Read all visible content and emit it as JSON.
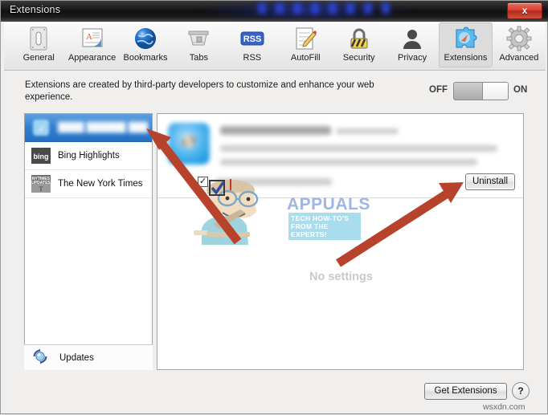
{
  "window": {
    "title": "Extensions",
    "close_label": "x"
  },
  "toolbar": {
    "items": [
      {
        "label": "General",
        "icon": "general-icon",
        "active": false
      },
      {
        "label": "Appearance",
        "icon": "appearance-icon",
        "active": false
      },
      {
        "label": "Bookmarks",
        "icon": "bookmarks-icon",
        "active": false
      },
      {
        "label": "Tabs",
        "icon": "tabs-icon",
        "active": false
      },
      {
        "label": "RSS",
        "icon": "rss-icon",
        "active": false
      },
      {
        "label": "AutoFill",
        "icon": "autofill-icon",
        "active": false
      },
      {
        "label": "Security",
        "icon": "security-icon",
        "active": false
      },
      {
        "label": "Privacy",
        "icon": "privacy-icon",
        "active": false
      },
      {
        "label": "Extensions",
        "icon": "extensions-icon",
        "active": true
      },
      {
        "label": "Advanced",
        "icon": "advanced-icon",
        "active": false
      }
    ]
  },
  "description": {
    "text": "Extensions are created by third-party developers to customize and enhance your web experience."
  },
  "toggle": {
    "off_label": "OFF",
    "on_label": "ON",
    "state": "ON"
  },
  "sidebar": {
    "items": [
      {
        "label": "",
        "icon": "extension-icon",
        "selected": true,
        "blurred": true
      },
      {
        "label": "Bing Highlights",
        "icon": "bing-icon",
        "selected": false,
        "blurred": false
      },
      {
        "label": "The New York Times",
        "icon": "nytimes-icon",
        "selected": false,
        "blurred": false
      }
    ],
    "updates_label": "Updates",
    "updates_icon": "refresh-icon"
  },
  "main": {
    "extension_icon": "extension-blue-icon",
    "checkbox_checked": true,
    "uninstall_label": "Uninstall",
    "no_settings_label": "No settings"
  },
  "footer": {
    "get_extensions_label": "Get Extensions",
    "help_label": "?",
    "watermark_source": "wsxdn.com"
  },
  "watermark": {
    "brand": "APPUALS",
    "tagline": "TECH HOW-TO'S FROM THE EXPERTS!"
  },
  "colors": {
    "selection_blue": "#2f7fd0",
    "arrow_red": "#b8432c",
    "close_red": "#d94030",
    "watermark_blue": "#9fb6e2",
    "tagline_bg": "#a9dced"
  }
}
